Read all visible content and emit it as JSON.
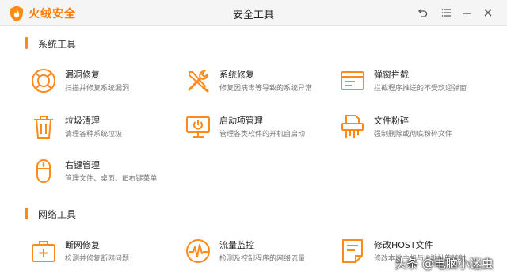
{
  "app": {
    "brand": "火绒安全",
    "window_title": "安全工具",
    "accent_color": "#ff8a1c"
  },
  "window_controls": [
    {
      "name": "back-icon"
    },
    {
      "name": "menu-icon"
    },
    {
      "name": "minimize-icon"
    },
    {
      "name": "close-icon"
    }
  ],
  "sections": [
    {
      "label": "系统工具"
    },
    {
      "label": "网络工具"
    }
  ],
  "tools": [
    {
      "icon": "lifebuoy-icon",
      "name": "漏洞修复",
      "desc": "扫描并修复系统漏洞"
    },
    {
      "icon": "wrench-screwdriver-icon",
      "name": "系统修复",
      "desc": "修复因病毒等导致的系统异常"
    },
    {
      "icon": "popup-window-icon",
      "name": "弹窗拦截",
      "desc": "拦截程序推送的不受欢迎弹窗"
    },
    {
      "icon": "trash-icon",
      "name": "垃圾清理",
      "desc": "清理各种系统垃圾"
    },
    {
      "icon": "monitor-power-icon",
      "name": "启动项管理",
      "desc": "管理各类软件的开机自启动"
    },
    {
      "icon": "shredder-icon",
      "name": "文件粉碎",
      "desc": "强制删除或彻底粉碎文件"
    },
    {
      "icon": "mouse-icon",
      "name": "右键管理",
      "desc": "管理文件、桌面、IE右键菜单"
    },
    {
      "icon": "first-aid-icon",
      "name": "断网修复",
      "desc": "检测并修复断网问题"
    },
    {
      "icon": "traffic-monitor-icon",
      "name": "流量监控",
      "desc": "检测及控制程序的网络流量"
    },
    {
      "icon": "hosts-file-icon",
      "name": "修改HOST文件",
      "desc": "修改本地主机与IP地址的映射"
    }
  ],
  "watermark": "头条 @电脑小迷虫"
}
